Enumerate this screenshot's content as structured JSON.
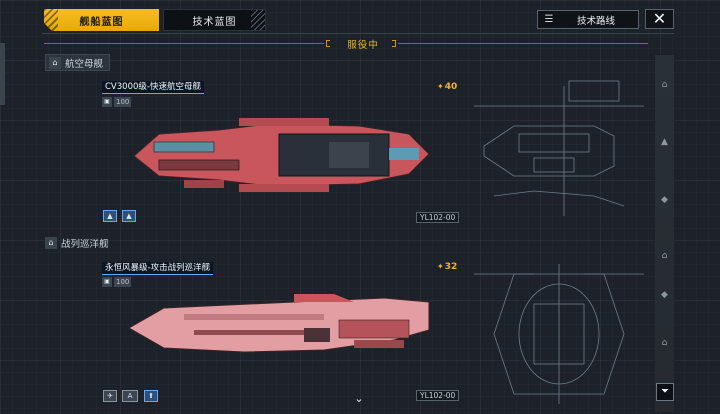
{
  "tabs": {
    "active_label": "舰船蓝图",
    "inactive_label": "技术蓝图"
  },
  "header": {
    "tech_route_label": "技术路线",
    "tech_route_icon": "list-icon",
    "close_icon": "close-icon",
    "status_label": "服役中"
  },
  "sections": [
    {
      "title": "航空母舰",
      "icon": "carrier-icon",
      "ship": {
        "name": "CV3000级-快速航空母舰",
        "meta_value": "100",
        "meta_icon": "ship-size-icon",
        "cost": "40",
        "badge": "YL102-00",
        "controls": [
          "aircraft-icon",
          "hangar-icon"
        ]
      }
    },
    {
      "title": "战列巡洋舰",
      "icon": "battlecruiser-icon",
      "ship": {
        "name": "永恒风暴级-攻击战列巡洋舰",
        "meta_value": "100",
        "meta_icon": "ship-size-icon",
        "cost": "32",
        "badge": "YL102-00",
        "controls": [
          "attack-icon",
          "armor-icon",
          "boost-icon"
        ],
        "control_labels": [
          "",
          "A",
          ""
        ]
      }
    }
  ],
  "colors": {
    "accent": "#f0b429",
    "background": "#1c2129",
    "ship_hull": "#c8565c",
    "name_underline": "#5fa9ff"
  },
  "rail_icons": [
    "tier-icon",
    "fighter-icon",
    "corvette-icon",
    "frigate-icon",
    "destroyer-icon",
    "cruiser-icon"
  ],
  "filter_icon": "filter-icon",
  "scroll_icon": "chevron-down-icon"
}
